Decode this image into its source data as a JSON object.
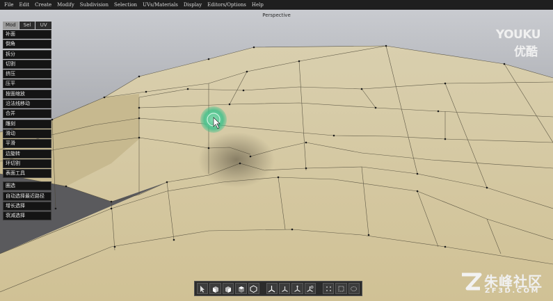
{
  "menubar": [
    "File",
    "Edit",
    "Create",
    "Modify",
    "Subdivision",
    "Selection",
    "UVs/Materials",
    "Display",
    "Editors/Options",
    "Help"
  ],
  "viewport": {
    "label": "Perspective"
  },
  "palette": {
    "tabs": [
      "Mod",
      "Sel",
      "UV"
    ],
    "active_tab": "Mod",
    "tools_top": [
      "补面",
      "倒角",
      "拆分",
      "切割",
      "挤压",
      "压平",
      "按面缩放",
      "沿法线移动",
      "合并",
      "雕刻",
      "滑动",
      "平滑",
      "边旋转",
      "环切割",
      "表面工具"
    ],
    "tools_bottom": [
      "圈选",
      "自动选择最近路径",
      "增长选择",
      "衰减选择"
    ]
  },
  "watermarks": {
    "youku_line1": "YOUKU",
    "youku_line2": "优酷",
    "zf3d_line1": "朱峰社区",
    "zf3d_line2": "ZF3D.COM"
  },
  "colors": {
    "mesh": "#d6c9a2",
    "menubar": "#1f1f1f",
    "cursor_ring": "#3fc08a"
  }
}
